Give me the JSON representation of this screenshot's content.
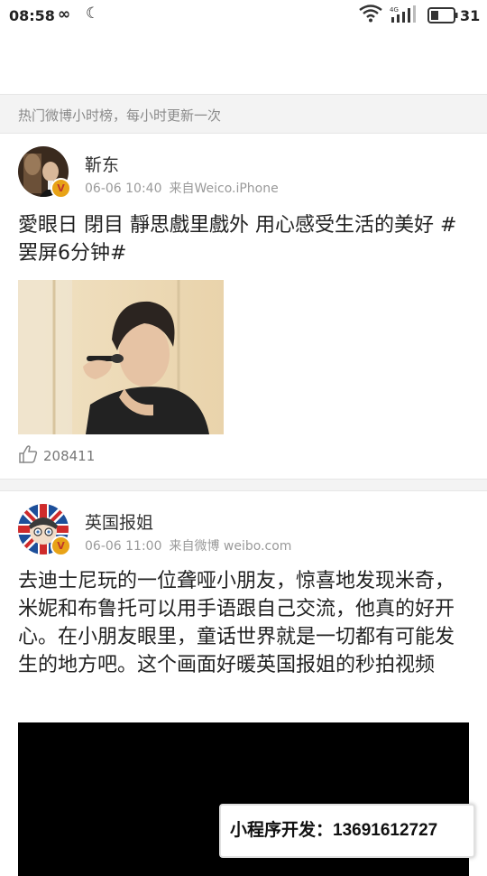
{
  "status_bar": {
    "time": "08:58",
    "network": "4G",
    "battery": "31"
  },
  "banner": {
    "text": "热门微博小时榜，每小时更新一次"
  },
  "posts": [
    {
      "user": "靳东",
      "time": "06-06 10:40",
      "source": "来自Weico.iPhone",
      "text": "愛眼日 閉目 靜思戲里戲外 用心感受生活的美好 #罢屏6分钟#",
      "likes": "208411",
      "verified_badge": "V"
    },
    {
      "user": "英国报姐",
      "time": "06-06 11:00",
      "source": "来自微博 weibo.com",
      "text": "去迪士尼玩的一位聋哑小朋友，惊喜地发现米奇，米妮和布鲁托可以用手语跟自己交流，他真的好开心。在小朋友眼里，童话世界就是一切都有可能发生的地方吧。这个画面好暖英国报姐的秒拍视频",
      "verified_badge": "V"
    }
  ],
  "promo": {
    "text": "小程序开发：13691612727"
  },
  "colors": {
    "badge": "#e8a317",
    "divider": "#f3f3f3",
    "muted": "#9a9a9a"
  }
}
